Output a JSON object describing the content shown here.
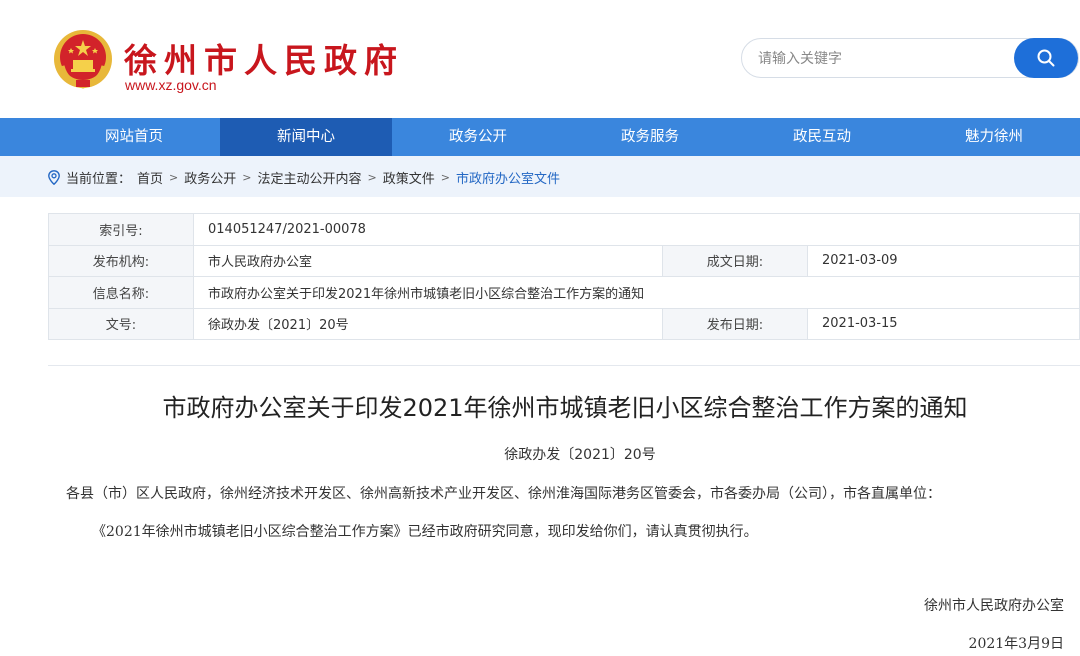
{
  "header": {
    "site_title": "徐州市人民政府",
    "site_url": "www.xz.gov.cn",
    "search_placeholder": "请输入关键字"
  },
  "nav": {
    "items": [
      {
        "label": "网站首页"
      },
      {
        "label": "新闻中心"
      },
      {
        "label": "政务公开"
      },
      {
        "label": "政务服务"
      },
      {
        "label": "政民互动"
      },
      {
        "label": "魅力徐州"
      }
    ],
    "active_index": 2
  },
  "breadcrumb": {
    "prefix": "当前位置：",
    "items": [
      "首页",
      "政务公开",
      "法定主动公开内容",
      "政策文件",
      "市政府办公室文件"
    ]
  },
  "meta": {
    "index_label": "索引号:",
    "index_value": "014051247/2021-00078",
    "publisher_label": "发布机构:",
    "publisher_value": "市人民政府办公室",
    "created_label": "成文日期:",
    "created_value": "2021-03-09",
    "name_label": "信息名称:",
    "name_value": "市政府办公室关于印发2021年徐州市城镇老旧小区综合整治工作方案的通知",
    "docno_label": "文号:",
    "docno_value": "徐政办发〔2021〕20号",
    "published_label": "发布日期:",
    "published_value": "2021-03-15"
  },
  "article": {
    "title": "市政府办公室关于印发2021年徐州市城镇老旧小区综合整治工作方案的通知",
    "doc_number": "徐政办发〔2021〕20号",
    "addressee": "各县（市）区人民政府，徐州经济技术开发区、徐州高新技术产业开发区、徐州淮海国际港务区管委会，市各委办局（公司），市各直属单位：",
    "body": "《2021年徐州市城镇老旧小区综合整治工作方案》已经市政府研究同意，现印发给你们，请认真贯彻执行。",
    "signer": "徐州市人民政府办公室",
    "date": "2021年3月9日"
  },
  "colors": {
    "brand_red": "#c8161d",
    "nav_blue": "#3a86dd",
    "nav_active": "#1e5cb3",
    "search_button": "#1e6fd9",
    "breadcrumb_bg": "#edf3fb"
  },
  "icons": {
    "emblem": "national-emblem-icon",
    "search": "search-icon",
    "location": "location-pin-icon"
  }
}
